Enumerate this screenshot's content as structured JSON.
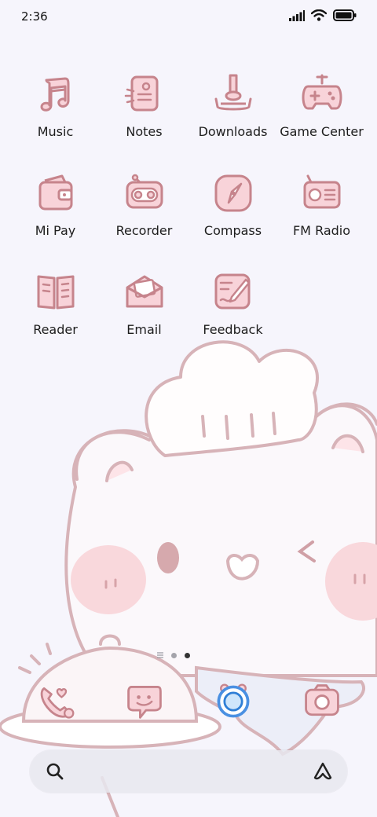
{
  "status": {
    "time": "2:36",
    "signal": "signal-icon",
    "wifi": "wifi-icon",
    "battery": "battery-icon"
  },
  "apps": [
    {
      "label": "Music",
      "icon": "music-icon"
    },
    {
      "label": "Notes",
      "icon": "notes-icon"
    },
    {
      "label": "Downloads",
      "icon": "downloads-icon"
    },
    {
      "label": "Game Center",
      "icon": "gamepad-icon"
    },
    {
      "label": "Mi Pay",
      "icon": "wallet-icon"
    },
    {
      "label": "Recorder",
      "icon": "recorder-icon"
    },
    {
      "label": "Compass",
      "icon": "compass-icon"
    },
    {
      "label": "FM Radio",
      "icon": "radio-icon"
    },
    {
      "label": "Reader",
      "icon": "book-icon"
    },
    {
      "label": "Email",
      "icon": "mail-icon"
    },
    {
      "label": "Feedback",
      "icon": "feedback-icon"
    }
  ],
  "page_indicator": {
    "pages": 3,
    "current": 3
  },
  "dock": [
    {
      "icon": "phone-icon"
    },
    {
      "icon": "messages-icon"
    },
    {
      "icon": "browser-icon"
    },
    {
      "icon": "camera-icon"
    }
  ],
  "search_bar": {
    "left_icon": "search-icon",
    "right_icon": "assistant-icon"
  },
  "colors": {
    "icon_fill": "#f8d3d9",
    "icon_stroke": "#c6848c",
    "background": "#f6f5fc",
    "wallpaper_line": "#d9b6ba"
  }
}
